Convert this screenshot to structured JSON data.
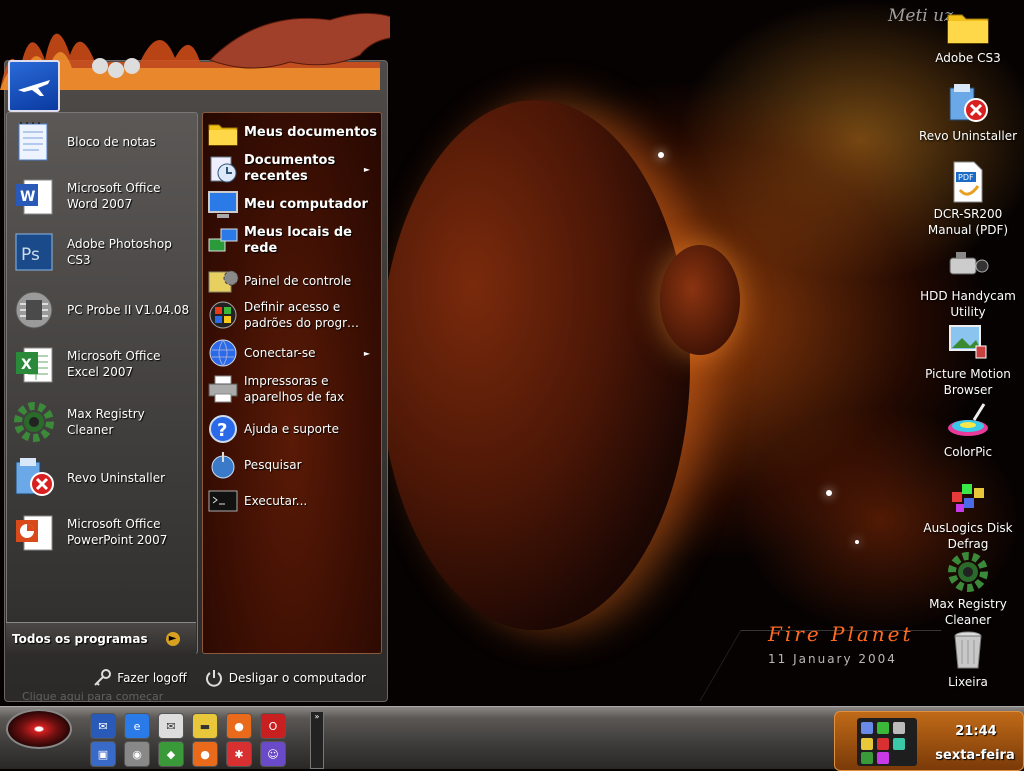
{
  "start_menu": {
    "pinned_programs": [
      {
        "label": "Bloco de notas",
        "icon": "notepad-icon"
      },
      {
        "label": "Microsoft Office Word 2007",
        "icon": "word-icon"
      },
      {
        "label": "Adobe Photoshop CS3",
        "icon": "photoshop-icon"
      },
      {
        "label": "PC Probe II V1.04.08",
        "icon": "pc-probe-icon"
      },
      {
        "label": "Microsoft Office Excel 2007",
        "icon": "excel-icon"
      },
      {
        "label": "Max Registry Cleaner",
        "icon": "gear-icon"
      },
      {
        "label": "Revo Uninstaller",
        "icon": "uninstaller-icon"
      },
      {
        "label": "Microsoft Office PowerPoint 2007",
        "icon": "powerpoint-icon"
      }
    ],
    "all_programs_label": "Todos os programas",
    "places": [
      {
        "label": "Meus documentos",
        "bold": true
      },
      {
        "label": "Documentos recentes",
        "bold": true,
        "submenu": true
      },
      {
        "label": "Meu computador",
        "bold": true
      },
      {
        "label": "Meus locais de rede",
        "bold": true
      },
      {
        "label": "Painel de controle"
      },
      {
        "label": "Definir acesso e padrões do progr…"
      },
      {
        "label": "Conectar-se",
        "submenu": true
      },
      {
        "label": "Impressoras e aparelhos de fax"
      },
      {
        "label": "Ajuda e suporte"
      },
      {
        "label": "Pesquisar"
      },
      {
        "label": "Executar..."
      }
    ],
    "logoff_label": "Fazer logoff",
    "shutdown_label": "Desligar o computador",
    "hint_text": "Clique aqui para começar"
  },
  "desktop_icons": [
    {
      "label": "Adobe CS3",
      "icon": "folder-icon"
    },
    {
      "label": "Revo Uninstaller",
      "icon": "uninstaller-icon"
    },
    {
      "label": "DCR-SR200 Manual (PDF)",
      "icon": "pdf-icon"
    },
    {
      "label": "HDD Handycam Utility",
      "icon": "camcorder-icon"
    },
    {
      "label": "Picture Motion Browser",
      "icon": "photo-browser-icon"
    },
    {
      "label": "ColorPic",
      "icon": "colorpic-icon"
    },
    {
      "label": "AusLogics Disk Defrag",
      "icon": "defrag-icon"
    },
    {
      "label": "Max Registry Cleaner",
      "icon": "gear-icon"
    },
    {
      "label": "Lixeira",
      "icon": "recycle-bin-icon"
    }
  ],
  "wallpaper": {
    "logo_text": "Meti   uz",
    "title": "Fire Planet",
    "date": "11 January 2004"
  },
  "taskbar": {
    "clock": "21:44",
    "day": "sexta-feira",
    "more_glyph": "»"
  },
  "colors": {
    "accent": "#d8a020",
    "tray": "#c06a18",
    "flame": "#ff6a20"
  }
}
